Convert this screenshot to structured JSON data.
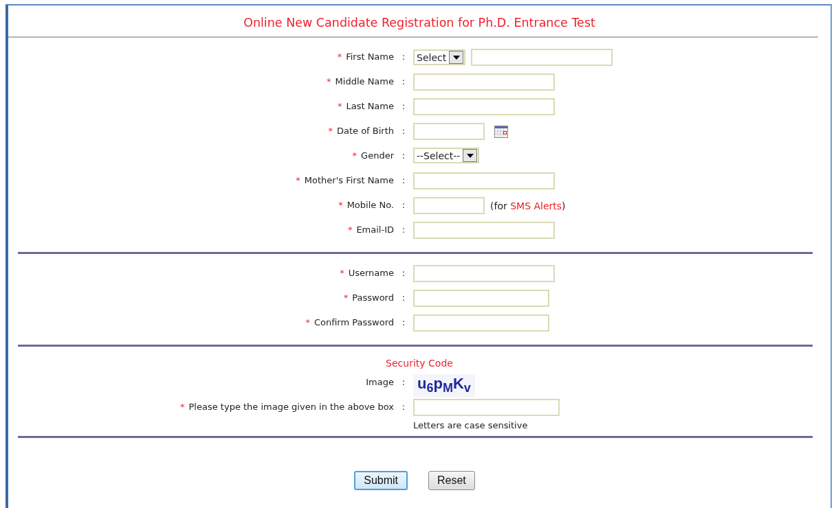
{
  "title": "Online New Candidate Registration for Ph.D. Entrance Test",
  "sections": [
    {
      "rows": [
        {
          "marker": "*",
          "label": "First Name",
          "separator": ":",
          "controls": [
            {
              "kind": "select",
              "value": "Select"
            },
            {
              "kind": "text"
            }
          ]
        },
        {
          "marker": "*",
          "label": "Middle Name",
          "separator": ":",
          "controls": [
            {
              "kind": "text"
            }
          ]
        },
        {
          "marker": "*",
          "label": "Last Name",
          "separator": ":",
          "controls": [
            {
              "kind": "text"
            }
          ]
        },
        {
          "marker": "*",
          "label": "Date of Birth",
          "separator": ":",
          "controls": [
            {
              "kind": "short-text"
            },
            {
              "kind": "calendar"
            }
          ]
        },
        {
          "marker": "*",
          "label": "Gender",
          "separator": ":",
          "controls": [
            {
              "kind": "select",
              "value": "--Select--"
            }
          ]
        },
        {
          "marker": "*",
          "label": "Mother's First Name",
          "separator": ":",
          "controls": [
            {
              "kind": "text"
            }
          ]
        },
        {
          "marker": "*",
          "label": "Mobile No.",
          "separator": ":",
          "controls": [
            {
              "kind": "short-text"
            },
            {
              "kind": "note",
              "before": "(for ",
              "highlight": "SMS Alerts",
              "after": ")"
            }
          ]
        },
        {
          "marker": "*",
          "label": "Email-ID",
          "separator": ":",
          "controls": [
            {
              "kind": "text"
            }
          ]
        }
      ]
    },
    {
      "rows": [
        {
          "marker": "*",
          "label": "Username",
          "separator": ":",
          "controls": [
            {
              "kind": "text"
            }
          ]
        },
        {
          "marker": "*",
          "label": "Password",
          "separator": ":",
          "controls": [
            {
              "kind": "password"
            }
          ]
        },
        {
          "marker": "*",
          "label": "Confirm Password",
          "separator": ":",
          "controls": [
            {
              "kind": "password"
            }
          ]
        }
      ]
    },
    {
      "heading": "Security Code",
      "rows": [
        {
          "label": "Image",
          "separator": ":",
          "controls": [
            {
              "kind": "captcha",
              "text": "u6pMKv"
            }
          ]
        },
        {
          "marker": "*",
          "label": "Please type the image given in the above box",
          "separator": ":",
          "controls": [
            {
              "kind": "long-text"
            }
          ],
          "hint": "Letters are case sensitive"
        }
      ]
    }
  ],
  "buttons": [
    {
      "label": "Submit",
      "focused": true
    },
    {
      "label": "Reset",
      "focused": false
    }
  ]
}
